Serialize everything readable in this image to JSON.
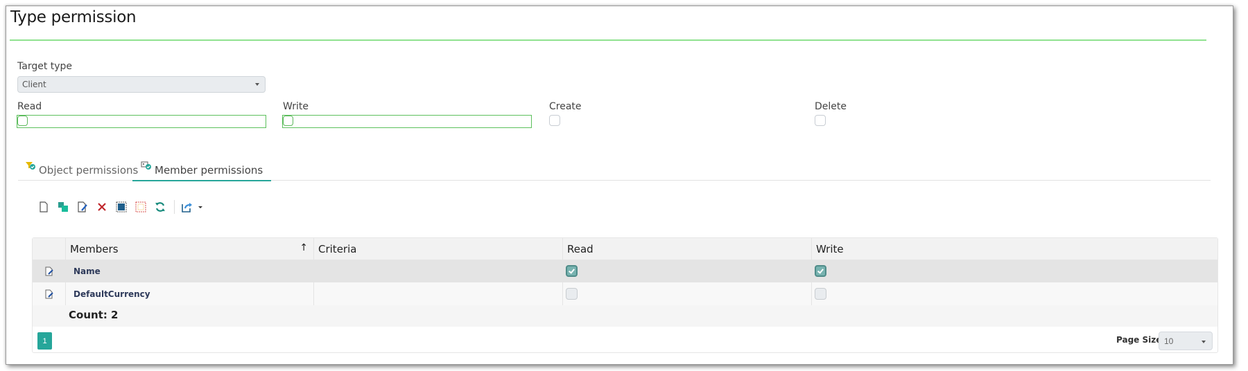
{
  "page": {
    "title": "Type permission"
  },
  "form": {
    "target_type": {
      "label": "Target type",
      "value": "Client"
    },
    "read": {
      "label": "Read",
      "checked": false
    },
    "write": {
      "label": "Write",
      "checked": false
    },
    "create": {
      "label": "Create",
      "checked": false
    },
    "delete": {
      "label": "Delete",
      "checked": false
    }
  },
  "tabs": [
    {
      "label": "Object permissions",
      "icon": "filter-check-icon",
      "active": false
    },
    {
      "label": "Member permissions",
      "icon": "members-check-icon",
      "active": true
    }
  ],
  "toolbar": {
    "buttons": [
      {
        "name": "new-button",
        "icon": "new-document-icon"
      },
      {
        "name": "clone-button",
        "icon": "clone-icon"
      },
      {
        "name": "edit-button",
        "icon": "edit-document-icon"
      },
      {
        "name": "delete-button",
        "icon": "delete-x-icon"
      },
      {
        "name": "select-all-button",
        "icon": "select-all-icon"
      },
      {
        "name": "unselect-all-button",
        "icon": "unselect-all-icon"
      },
      {
        "name": "refresh-button",
        "icon": "refresh-icon"
      },
      {
        "name": "export-button",
        "icon": "export-icon"
      }
    ]
  },
  "grid": {
    "columns": [
      {
        "label": "",
        "key": "edit"
      },
      {
        "label": "Members",
        "key": "members",
        "sort": "ascending"
      },
      {
        "label": "Criteria",
        "key": "criteria"
      },
      {
        "label": "Read",
        "key": "read"
      },
      {
        "label": "Write",
        "key": "write"
      }
    ],
    "rows": [
      {
        "members": "Name",
        "criteria": "",
        "read": true,
        "write": true,
        "selected": true
      },
      {
        "members": "DefaultCurrency",
        "criteria": "",
        "read": false,
        "write": false,
        "selected": false
      }
    ],
    "count_label": "Count: 2",
    "pager": {
      "current_page": "1",
      "page_size_label": "Page Size:",
      "page_size": "10"
    }
  },
  "colors": {
    "accent": "#26a69a",
    "title_rule": "#90e290",
    "bool_border": "#5cb85c"
  }
}
